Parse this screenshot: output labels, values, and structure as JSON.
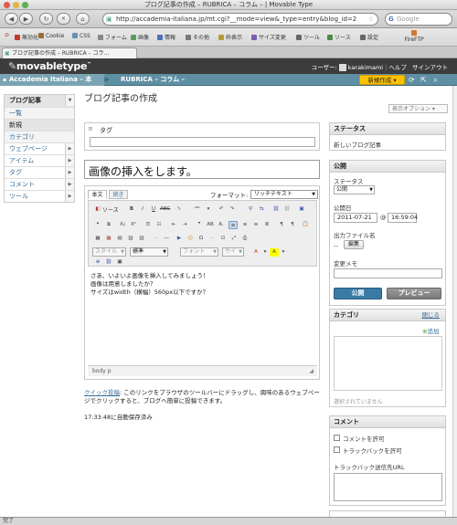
{
  "window": {
    "title": "ブログ記事の作成 – RUBRICA – コラム – | Movable Type"
  },
  "browser": {
    "url": "http://accademia-italiana.jp/mt.cgi?__mode=view&_type=entry&blog_id=2",
    "search_placeholder": "Google",
    "bookmarks": [
      {
        "label": "無効化",
        "color": "#c0392b"
      },
      {
        "label": "Cookie",
        "color": "#9b6b3a"
      },
      {
        "label": "CSS",
        "color": "#6b8fb5"
      },
      {
        "label": "フォーム",
        "color": "#888888"
      },
      {
        "label": "画像",
        "color": "#5b9b5b"
      },
      {
        "label": "情報",
        "color": "#4a74b5"
      },
      {
        "label": "その他",
        "color": "#777777"
      },
      {
        "label": "枠表示",
        "color": "#b59a3a"
      },
      {
        "label": "サイズ変更",
        "color": "#7a5bb5"
      },
      {
        "label": "ツール",
        "color": "#666666"
      },
      {
        "label": "ソース",
        "color": "#4a8a4a"
      },
      {
        "label": "設定",
        "color": "#666666"
      },
      {
        "label": "FireFTP",
        "color": "#d6762b"
      }
    ],
    "tab_label": "ブログ記事の作成 – RUBRICA – コラ...",
    "status_text": "完了"
  },
  "header": {
    "logo": "movabletype",
    "user_label": "ユーザー:",
    "username": "karakimami",
    "help": "ヘルプ",
    "signout": "サインアウト"
  },
  "blognav": {
    "site": "Accademia Italiana – 本",
    "blog": "RUBRICA – コラム –",
    "new_button": "新規作成"
  },
  "sidebar": {
    "head": "ブログ記事",
    "items": [
      {
        "label": "一覧"
      },
      {
        "label": "新規"
      },
      {
        "label": "カテゴリ"
      },
      {
        "label": "ウェブページ"
      },
      {
        "label": "アイテム"
      },
      {
        "label": "タグ"
      },
      {
        "label": "コメント"
      },
      {
        "label": "ツール"
      }
    ]
  },
  "main": {
    "page_title": "ブログ記事の作成",
    "display_options": "表示オプション",
    "tag_label": "タグ",
    "entry_title": "画像の挿入をします。",
    "tab_body": "本文",
    "tab_more": "続き",
    "format_label": "フォーマット:",
    "format_value": "リッチテキスト",
    "style_select": "スタイル",
    "format_select": "標準",
    "font_select": "フォント",
    "size_select": "サイ",
    "body_lines": [
      "さあ、いよいよ画像を挿入してみましょう！",
      "画像は用意しましたか？",
      "サイズはwidth（横幅）560px以下ですか？"
    ],
    "editor_path": "body  p",
    "quickpost_link": "クイック投稿",
    "quickpost_text": ": このリンクをブラウザのツールバーにドラッグし、興味のあるウェブページでクリックすると、ブログへ簡単に投稿できます。",
    "autosave": "17:33:48に自動保存済み"
  },
  "right": {
    "status_head": "ステータス",
    "status_value": "新しいブログ記事",
    "publish_head": "公開",
    "status_label": "ステータス",
    "status_select": "公開",
    "date_label": "公開日",
    "date_value": "2011-07-21",
    "at": "@",
    "time_value": "16:59:04",
    "outfile_label": "出力ファイル名",
    "outfile_dash": "--",
    "edit_button": "編集",
    "memo_label": "変更メモ",
    "publish_button": "公開",
    "preview_button": "プレビュー",
    "category_head": "カテゴリ",
    "close": "閉じる",
    "add": "追加",
    "no_category": "選択されていません",
    "comment_head": "コメント",
    "allow_comments": "コメントを許可",
    "allow_trackbacks": "トラックバックを許可",
    "trackback_label": "トラックバック送信先URL",
    "accent": "#3a7aa6",
    "highlight": "#ffc200"
  }
}
